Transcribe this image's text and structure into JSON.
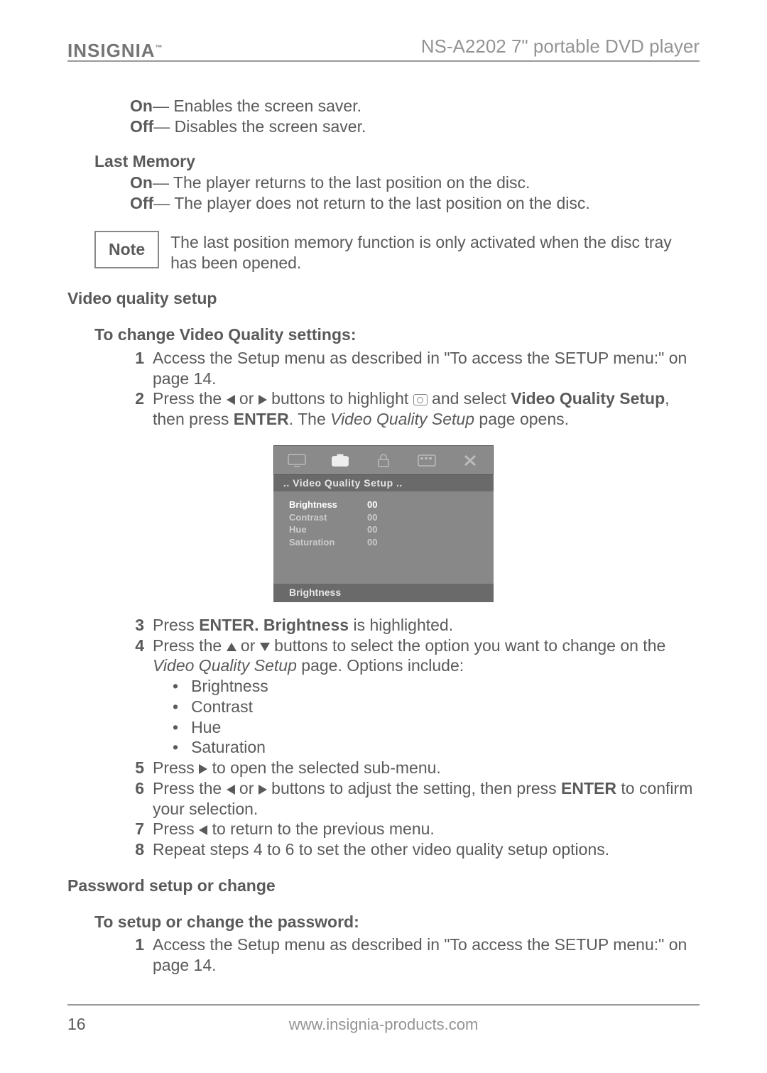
{
  "header": {
    "brand": "INSIGNIA",
    "product": "NS-A2202 7\" portable DVD player"
  },
  "screen_saver": {
    "on": {
      "term": "On",
      "desc": " — Enables the screen saver."
    },
    "off": {
      "term": "Off",
      "desc": " — Disables the screen saver."
    }
  },
  "last_memory": {
    "heading": "Last Memory",
    "on": {
      "term": "On",
      "desc": " — The player returns to the last position on the disc."
    },
    "off": {
      "term": "Off",
      "desc": " — The player does not return to the last position on the disc."
    }
  },
  "note": {
    "label": "Note",
    "text": "The last position memory function is only activated when the disc tray has been opened."
  },
  "vqs": {
    "heading": "Video quality setup",
    "subheading": "To change Video Quality settings:",
    "s1_a": "Access the Setup menu as described in \"To access the SETUP menu:\" on page 14.",
    "s2_a": "Press the ",
    "s2_b": " or ",
    "s2_c": " buttons to highlight ",
    "s2_d": " and select ",
    "s2_e": "Video Quality Setup",
    "s2_f": ", then press ",
    "s2_g": "ENTER",
    "s2_h": ". The ",
    "s2_i": "Video Quality Setup",
    "s2_j": " page opens.",
    "s3_a": "Press ",
    "s3_b": "ENTER. Brightness",
    "s3_c": " is highlighted.",
    "s4_a": "Press the ",
    "s4_b": " or ",
    "s4_c": " buttons to select the option you want to change on the ",
    "s4_d": "Video Quality Setup",
    "s4_e": " page. Options include:",
    "opt1": "Brightness",
    "opt2": "Contrast",
    "opt3": "Hue",
    "opt4": "Saturation",
    "s5_a": "Press ",
    "s5_b": " to open the selected sub-menu.",
    "s6_a": "Press the ",
    "s6_b": " or ",
    "s6_c": " buttons to adjust the setting, then press ",
    "s6_d": "ENTER",
    "s6_e": " to confirm your selection.",
    "s7_a": "Press ",
    "s7_b": " to return to the previous menu.",
    "s8_a": "Repeat steps 4 to 6 to set the other video quality setup options."
  },
  "osd": {
    "title": "..   Video  Quality  Setup   ..",
    "rows": [
      {
        "label": "Brightness",
        "value": "00"
      },
      {
        "label": "Contrast",
        "value": "00"
      },
      {
        "label": "Hue",
        "value": "00"
      },
      {
        "label": "Saturation",
        "value": "00"
      }
    ],
    "footer": "Brightness"
  },
  "pwd": {
    "heading": "Password setup or change",
    "subheading": "To setup or change the password:",
    "s1": "Access the Setup menu as described in \"To access the SETUP menu:\" on page 14."
  },
  "footer": {
    "url": "www.insignia-products.com",
    "page": "16"
  }
}
